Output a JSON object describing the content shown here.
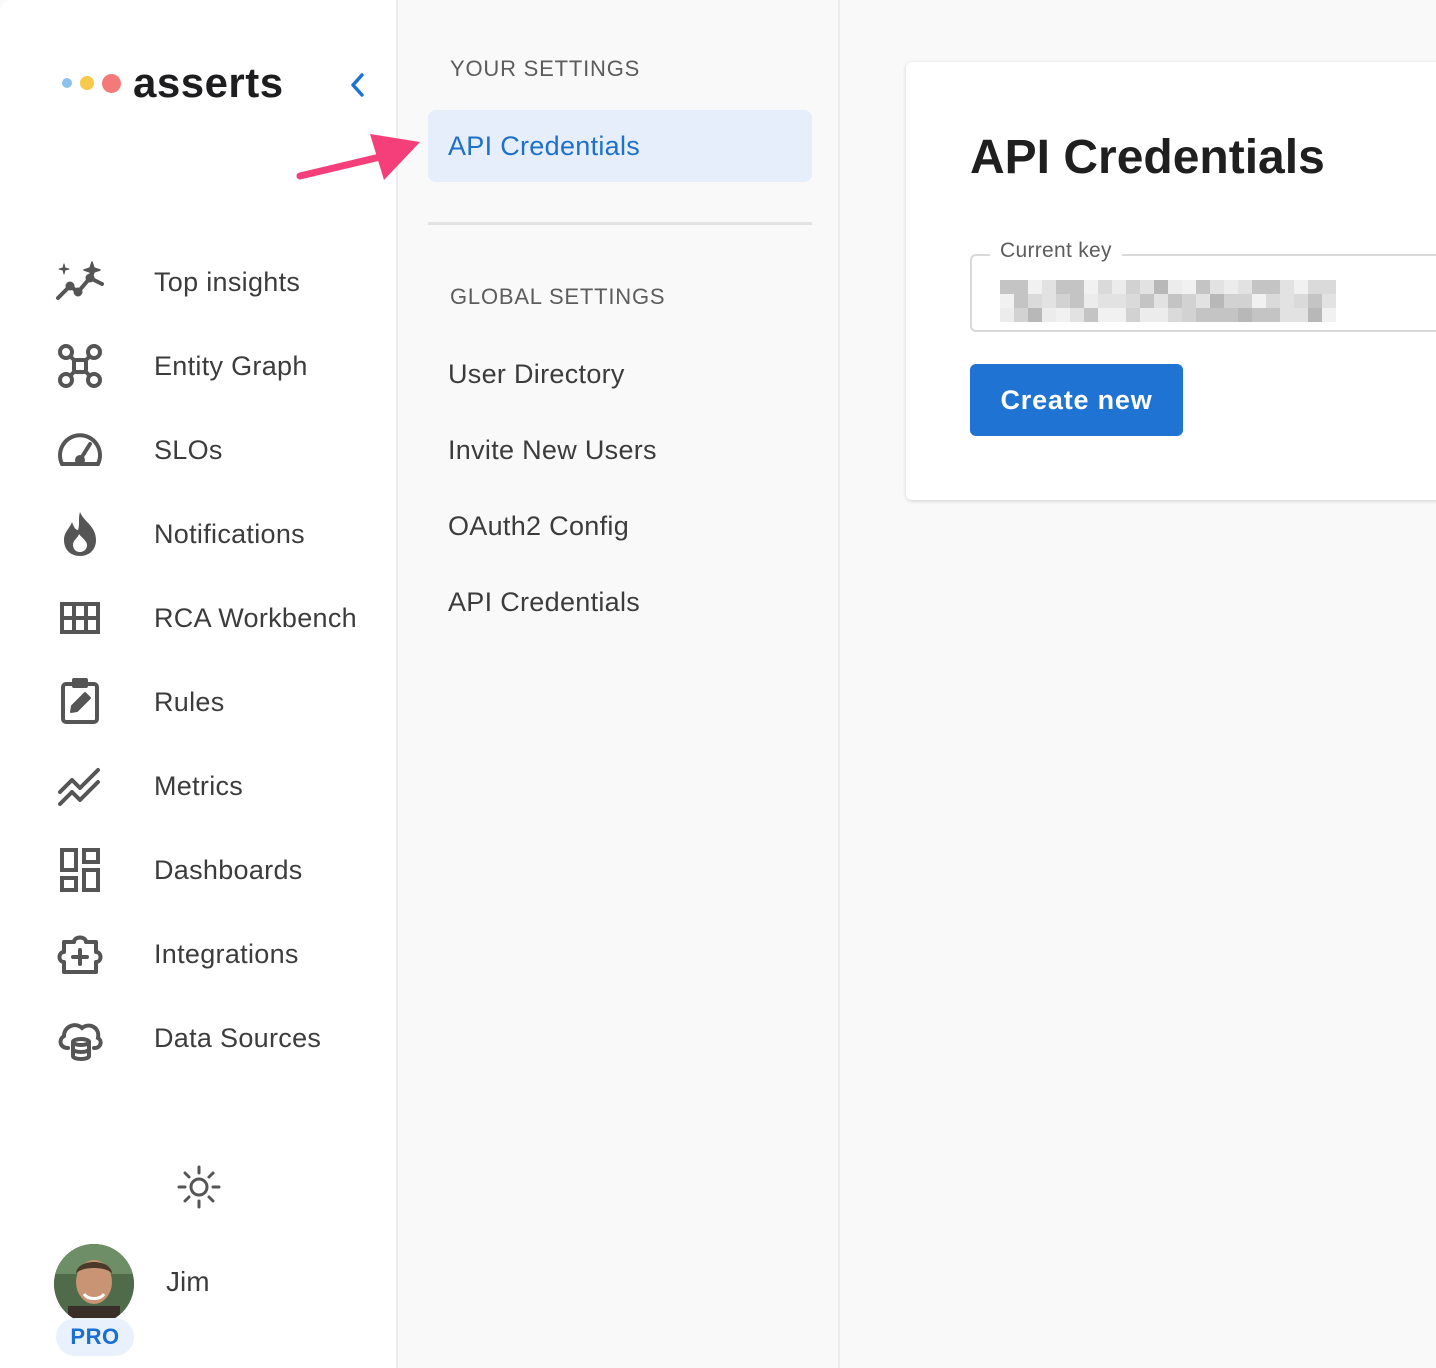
{
  "brand": {
    "name": "asserts"
  },
  "sidebar": {
    "collapse_icon": "chevron-left-icon",
    "items": [
      {
        "label": "Top insights",
        "icon": "insights-sparkle-icon"
      },
      {
        "label": "Entity Graph",
        "icon": "entity-graph-icon"
      },
      {
        "label": "SLOs",
        "icon": "speedometer-icon"
      },
      {
        "label": "Notifications",
        "icon": "flame-icon"
      },
      {
        "label": "RCA Workbench",
        "icon": "grid-table-icon"
      },
      {
        "label": "Rules",
        "icon": "edit-clipboard-icon"
      },
      {
        "label": "Metrics",
        "icon": "stacked-line-chart-icon"
      },
      {
        "label": "Dashboards",
        "icon": "dashboard-icon"
      },
      {
        "label": "Integrations",
        "icon": "add-integration-icon"
      },
      {
        "label": "Data Sources",
        "icon": "cloud-database-icon"
      }
    ],
    "theme_icon": "sun-icon",
    "user": {
      "name": "Jim",
      "badge": "PRO"
    }
  },
  "settings": {
    "your_title": "YOUR SETTINGS",
    "your_items": [
      {
        "label": "API Credentials",
        "active": true
      }
    ],
    "global_title": "GLOBAL SETTINGS",
    "global_items": [
      {
        "label": "User Directory"
      },
      {
        "label": "Invite New Users"
      },
      {
        "label": "OAuth2 Config"
      },
      {
        "label": "API Credentials"
      }
    ]
  },
  "main": {
    "card_title": "API Credentials",
    "current_key_label": "Current key",
    "current_key_value": "",
    "create_button": "Create new"
  },
  "colors": {
    "accent": "#1f73d3",
    "active_bg": "#e5eefa",
    "annotation_arrow": "#f43f7a",
    "logo_dots": [
      "#8cc0ee",
      "#f7c948",
      "#f47a7a"
    ]
  }
}
